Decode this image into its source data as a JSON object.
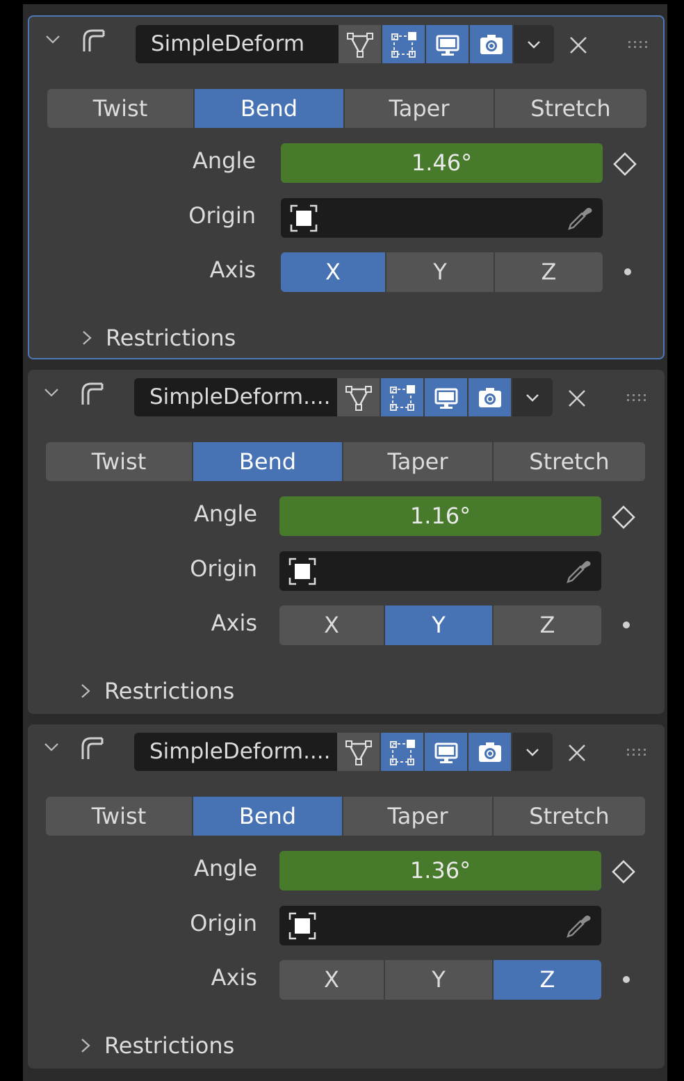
{
  "modifiers": [
    {
      "name": "SimpleDeform",
      "active": true,
      "mode_options": [
        "Twist",
        "Bend",
        "Taper",
        "Stretch"
      ],
      "selected_mode": "Bend",
      "angle_label": "Angle",
      "angle_value": "1.46°",
      "origin_label": "Origin",
      "axis_label": "Axis",
      "axis_options": [
        "X",
        "Y",
        "Z"
      ],
      "selected_axis": "X",
      "restrictions_label": "Restrictions"
    },
    {
      "name": "SimpleDeform....",
      "active": false,
      "mode_options": [
        "Twist",
        "Bend",
        "Taper",
        "Stretch"
      ],
      "selected_mode": "Bend",
      "angle_label": "Angle",
      "angle_value": "1.16°",
      "origin_label": "Origin",
      "axis_label": "Axis",
      "axis_options": [
        "X",
        "Y",
        "Z"
      ],
      "selected_axis": "Y",
      "restrictions_label": "Restrictions"
    },
    {
      "name": "SimpleDeform....",
      "active": false,
      "mode_options": [
        "Twist",
        "Bend",
        "Taper",
        "Stretch"
      ],
      "selected_mode": "Bend",
      "angle_label": "Angle",
      "angle_value": "1.36°",
      "origin_label": "Origin",
      "axis_label": "Axis",
      "axis_options": [
        "X",
        "Y",
        "Z"
      ],
      "selected_axis": "Z",
      "restrictions_label": "Restrictions"
    }
  ],
  "icons": {
    "collapse": "chevron-down-icon",
    "modifier_type": "simple-deform-icon",
    "on_cage": "on-cage-icon",
    "edit_mode": "edit-mode-icon",
    "viewport": "monitor-icon",
    "render": "camera-icon",
    "dropdown": "chevron-down-icon",
    "delete": "close-icon",
    "drag": "grip-icon",
    "keyframe": "keyframe-diamond-icon",
    "origin_object": "object-icon",
    "eyedropper": "eyedropper-icon",
    "restrictions_expand": "chevron-right-icon"
  },
  "colors": {
    "accent": "#4772b3",
    "angle_field": "#477a2a",
    "panel": "#3d3d3d",
    "active_outline": "#4d78b8"
  }
}
